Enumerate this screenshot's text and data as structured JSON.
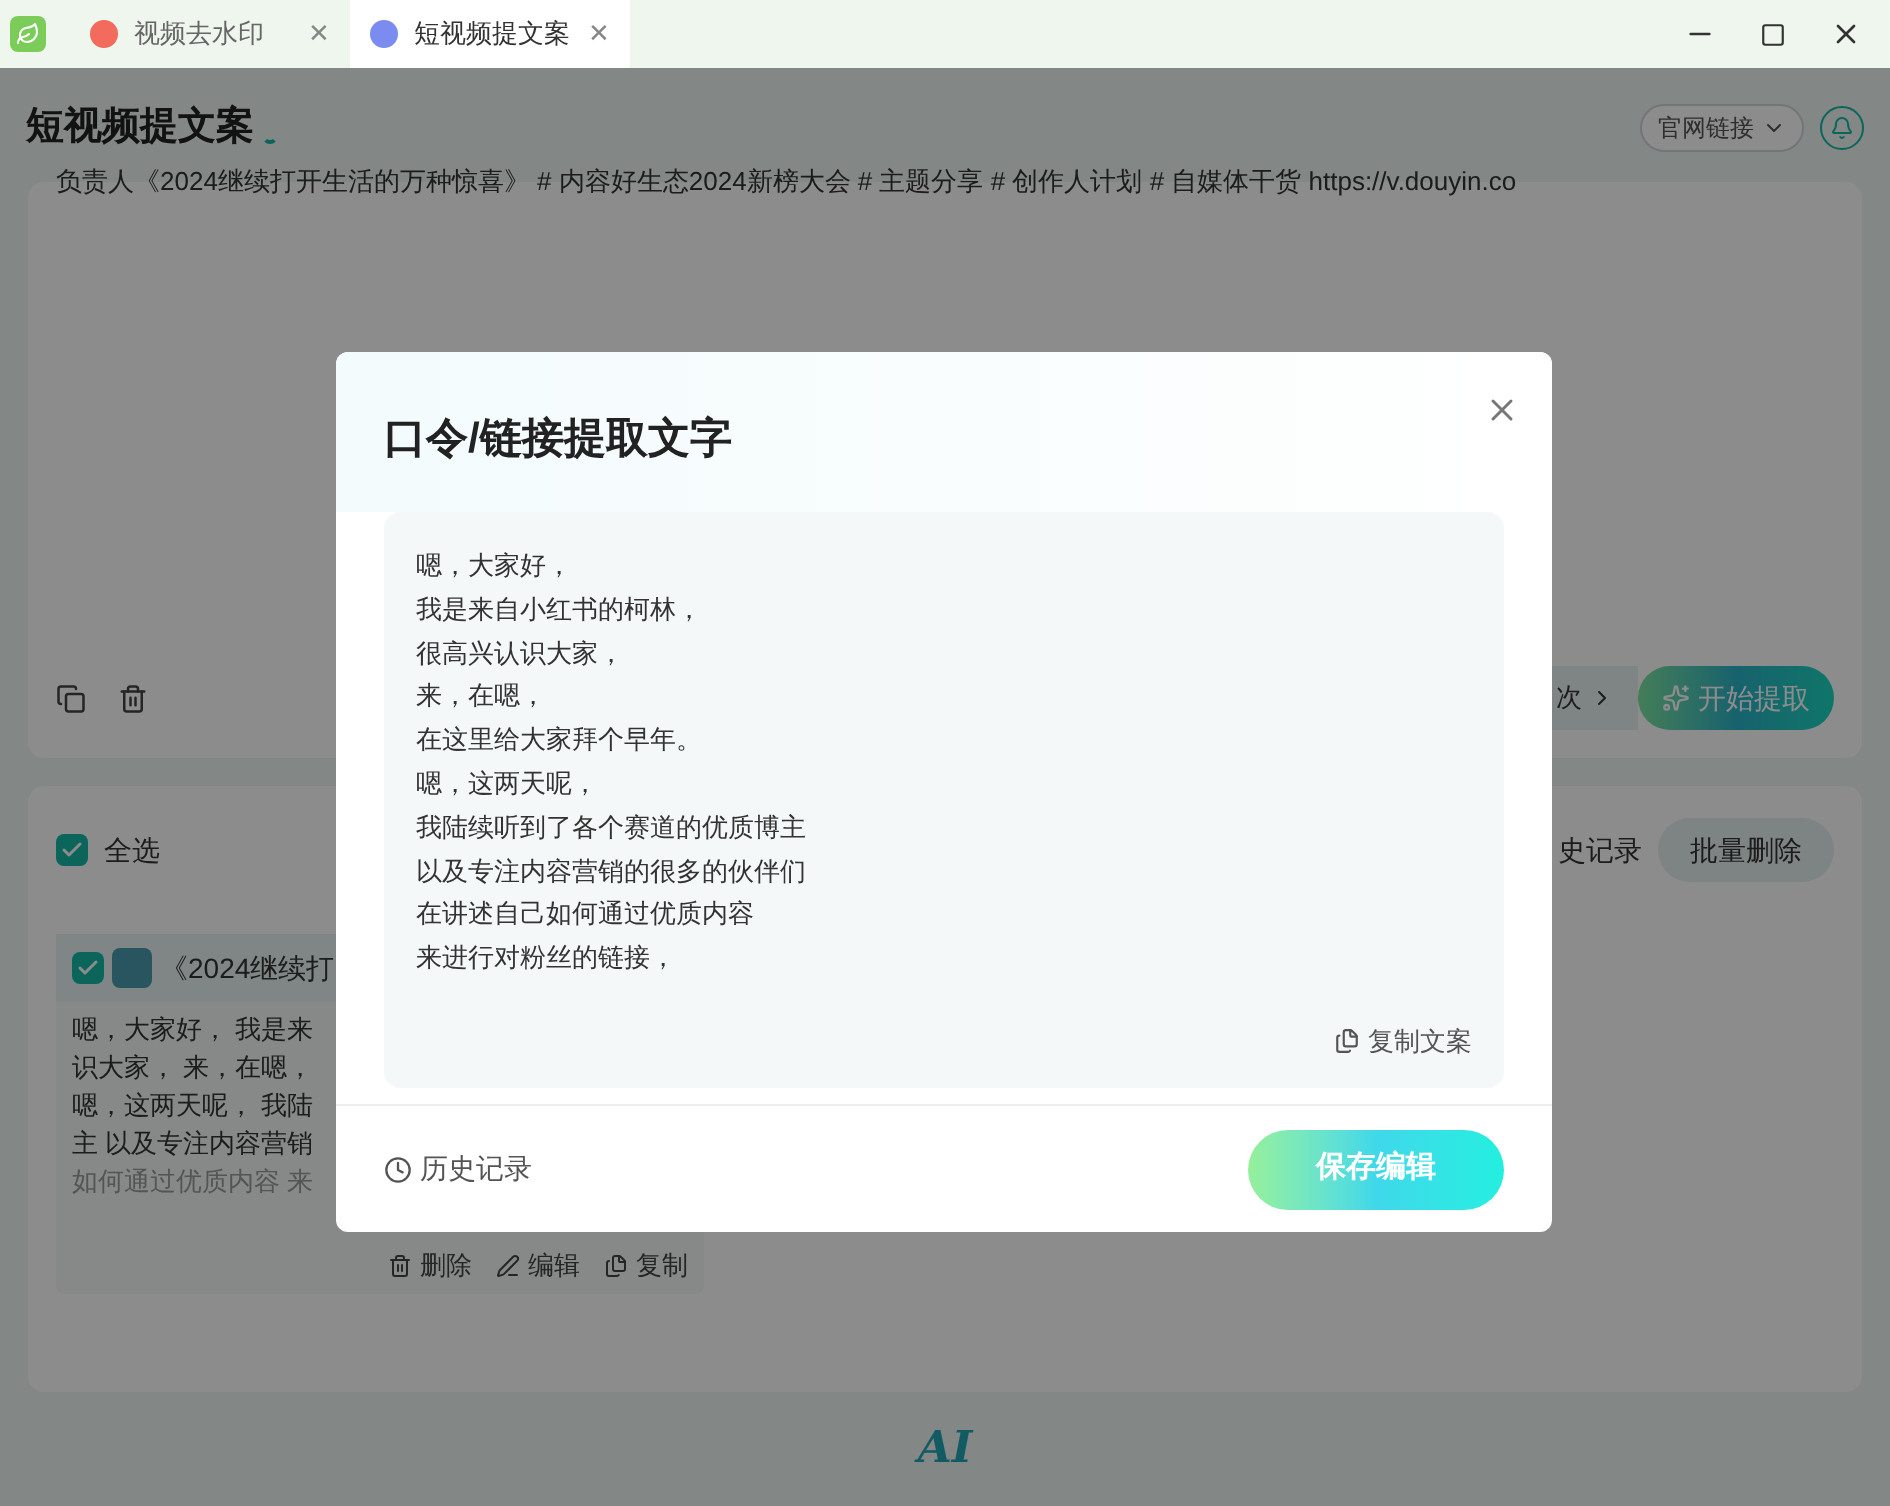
{
  "tabs": [
    {
      "label": "视频去水印",
      "selected": false,
      "close": "✕"
    },
    {
      "label": "短视频提文案",
      "selected": true,
      "close": "✕"
    }
  ],
  "header": {
    "title": "短视频提文案",
    "link_select": "官网链接"
  },
  "input_card": {
    "text": "负责人《2024继续打开生活的万种惊喜》 # 内容好生态2024新榜大会 # 主题分享 # 创作人计划 # 自媒体干货 https://v.douyin.co",
    "quota_suffix": "次",
    "start_button": "开始提取"
  },
  "results": {
    "select_all": {
      "label": "全选",
      "checked": true
    },
    "history_partial": "史记录",
    "batch_delete": "批量删除",
    "items": [
      {
        "checked": true,
        "title": "《2024继续打",
        "lines": [
          "嗯，大家好， 我是来",
          "识大家， 来，在嗯，",
          "嗯，这两天呢， 我陆",
          "主 以及专注内容营销",
          "如何通过优质内容 来"
        ],
        "actions": [
          "删除",
          "编辑",
          "复制"
        ]
      }
    ]
  },
  "modal": {
    "title": "口令/链接提取文字",
    "lines": [
      "嗯，大家好，",
      "我是来自小红书的柯林，",
      "很高兴认识大家，",
      "来，在嗯，",
      "在这里给大家拜个早年。",
      "嗯，这两天呢，",
      "我陆续听到了各个赛道的优质博主",
      "以及专注内容营销的很多的伙伴们",
      "在讲述自己如何通过优质内容",
      "来进行对粉丝的链接，"
    ],
    "copy": "复制文案",
    "history": "历史记录",
    "save": "保存编辑"
  },
  "footer_logo": "AI"
}
